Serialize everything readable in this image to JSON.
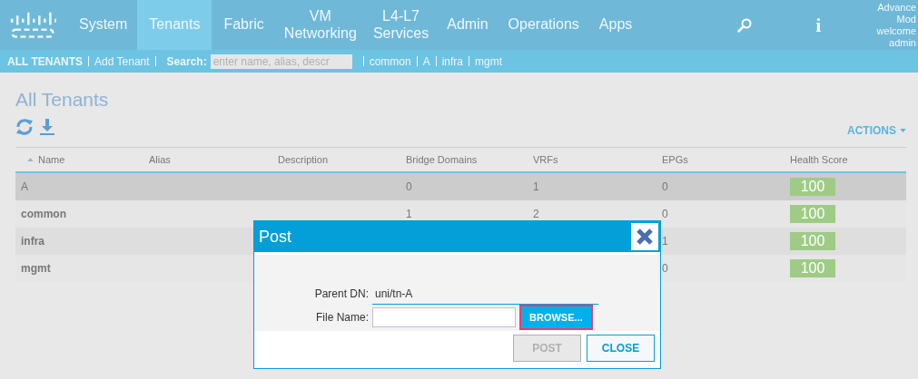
{
  "nav": {
    "tabs": [
      {
        "label": "System",
        "selected": false
      },
      {
        "label": "Tenants",
        "selected": true
      },
      {
        "label": "Fabric",
        "selected": false
      },
      {
        "label": "VM Networking",
        "selected": false
      },
      {
        "label": "L4-L7 Services",
        "selected": false
      },
      {
        "label": "Admin",
        "selected": false
      },
      {
        "label": "Operations",
        "selected": false
      },
      {
        "label": "Apps",
        "selected": false
      }
    ],
    "info": "i",
    "user_lines": [
      "Advance",
      "Mod",
      "welcome",
      "admin"
    ]
  },
  "subnav": {
    "links": [
      "ALL TENANTS",
      "Add Tenant"
    ],
    "search_label": "Search:",
    "search_placeholder": "enter name, alias, descr",
    "quick_links": [
      "common",
      "A",
      "infra",
      "mgmt"
    ]
  },
  "page": {
    "title": "All Tenants",
    "actions": "ACTIONS"
  },
  "table": {
    "columns": [
      "Name",
      "Alias",
      "Description",
      "Bridge Domains",
      "VRFs",
      "EPGs",
      "Health Score"
    ],
    "rows": [
      {
        "name": "A",
        "bridge_domains": "0",
        "vrfs": "1",
        "epgs": "0",
        "health": "100",
        "selected": true
      },
      {
        "name": "common",
        "bridge_domains": "1",
        "vrfs": "2",
        "epgs": "0",
        "health": "100",
        "selected": false
      },
      {
        "name": "infra",
        "epgs": "1",
        "health": "100",
        "selected": false
      },
      {
        "name": "mgmt",
        "epgs": "0",
        "health": "100",
        "selected": false
      }
    ]
  },
  "dialog": {
    "title": "Post",
    "parent_dn_label": "Parent DN:",
    "parent_dn": "uni/tn-A",
    "file_name_label": "File Name:",
    "browse": "BROWSE...",
    "post": {
      "label": "POST",
      "disabled": true
    },
    "close": "CLOSE"
  }
}
